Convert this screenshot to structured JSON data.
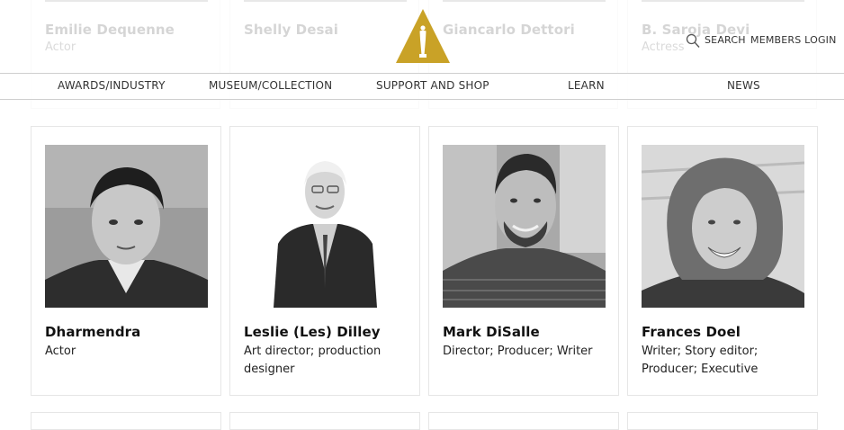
{
  "nav": {
    "items": [
      "AWARDS/INDUSTRY",
      "MUSEUM/COLLECTION",
      "SUPPORT AND SHOP",
      "LEARN",
      "NEWS"
    ],
    "search_label": "SEARCH",
    "login_label": "MEMBERS LOGIN",
    "logo_color": "#c9a227"
  },
  "faded_row": [
    {
      "name": "Emilie Dequenne",
      "role": "Actor"
    },
    {
      "name": "Shelly Desai",
      "role": ""
    },
    {
      "name": "Giancarlo Dettori",
      "role": ""
    },
    {
      "name": "B. Saroja Devi",
      "role": "Actress"
    }
  ],
  "people": [
    {
      "name": "Dharmendra",
      "role": "Actor"
    },
    {
      "name": "Leslie (Les) Dilley",
      "role": "Art director; production designer"
    },
    {
      "name": "Mark DiSalle",
      "role": "Director; Producer; Writer"
    },
    {
      "name": "Frances Doel",
      "role": "Writer; Story editor; Producer; Executive"
    }
  ]
}
